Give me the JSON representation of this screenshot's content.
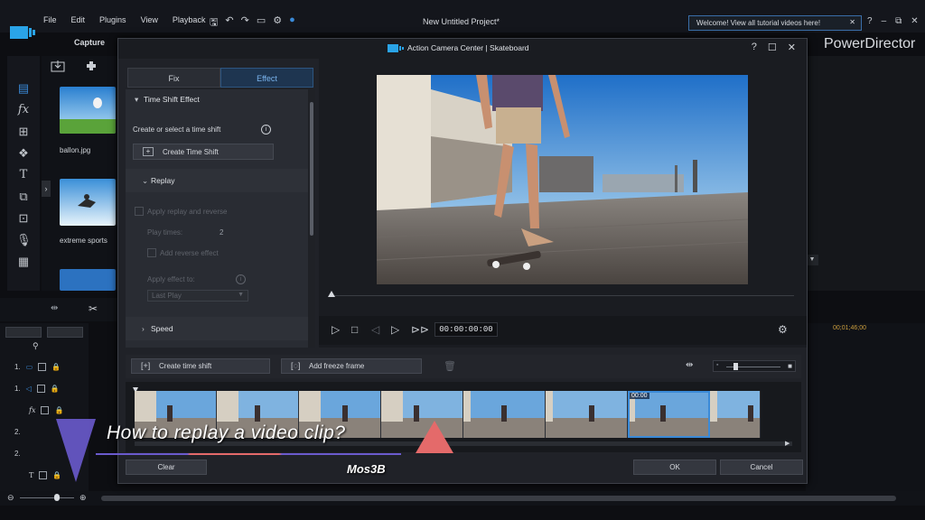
{
  "app": {
    "menu": [
      "File",
      "Edit",
      "Plugins",
      "View",
      "Playback"
    ],
    "project_title": "New Untitled Project*",
    "welcome_banner": "Welcome! View all tutorial videos here!",
    "close_glyph": "✕",
    "window_controls": [
      "?",
      "–",
      "⧉",
      "✕"
    ],
    "capture_tab": "Capture",
    "brand": "PowerDirector",
    "accent": "#3a8ad8"
  },
  "library": {
    "items": [
      {
        "label": "ballon.jpg"
      },
      {
        "label": "extreme sports"
      }
    ]
  },
  "timeline": {
    "right_time": "00;01;46;00",
    "tracks": [
      {
        "label": "1."
      },
      {
        "label": "1."
      },
      {
        "label": "fx"
      },
      {
        "label": "2."
      },
      {
        "label": "2."
      },
      {
        "label": "T"
      }
    ]
  },
  "dialog": {
    "title": "Action Camera Center | Skateboard",
    "controls": [
      "?",
      "☐",
      "✕"
    ],
    "tabs": [
      {
        "label": "Fix",
        "active": false
      },
      {
        "label": "Effect",
        "active": true
      }
    ],
    "time_shift_effect": {
      "heading": "Time Shift Effect",
      "prompt": "Create or select a time shift",
      "create_button": "Create Time Shift"
    },
    "replay": {
      "heading": "Replay",
      "apply_replay": "Apply replay and reverse",
      "play_times_label": "Play times:",
      "play_times_value": "2",
      "add_reverse": "Add reverse effect",
      "apply_effect_to": "Apply effect to:",
      "apply_effect_value": "Last Play"
    },
    "speed_heading": "Speed",
    "preview": {
      "timecode": "00:00:00:00"
    },
    "bottom_tools": {
      "create_time_shift": "Create time shift",
      "add_freeze_frame": "Add freeze frame"
    },
    "filmstrip": {
      "selected_index": 6,
      "selected_badge": "00:00"
    },
    "buttons": {
      "clear": "Clear",
      "ok": "OK",
      "cancel": "Cancel"
    }
  },
  "overlay": {
    "title": "How to replay a video clip?",
    "channel": "Mos3B"
  }
}
